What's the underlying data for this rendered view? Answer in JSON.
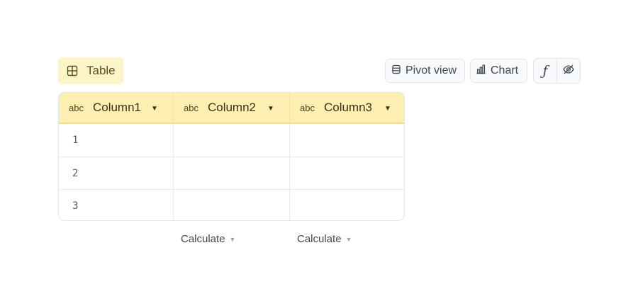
{
  "tabs": {
    "table_label": "Table"
  },
  "toolbar": {
    "pivot_label": "Pivot view",
    "chart_label": "Chart",
    "formula_glyph": "ƒ"
  },
  "columns": [
    {
      "type": "abc",
      "name": "Column1"
    },
    {
      "type": "abc",
      "name": "Column2"
    },
    {
      "type": "abc",
      "name": "Column3"
    }
  ],
  "rows": [
    {
      "col1": "1",
      "col2": "",
      "col3": ""
    },
    {
      "col1": "2",
      "col2": "",
      "col3": ""
    },
    {
      "col1": "3",
      "col2": "",
      "col3": ""
    }
  ],
  "footer": {
    "col2_calc": "Calculate",
    "col3_calc": "Calculate"
  },
  "glyphs": {
    "caret": "▼"
  },
  "icons": {
    "table_tab": "table-grid-icon",
    "pivot": "database-icon",
    "chart": "bar-chart-icon",
    "formula": "function-icon",
    "hide": "eye-off-icon",
    "column_menu": "caret-down-icon"
  },
  "colors": {
    "header_bg": "#fdefb2",
    "tab_bg": "#fdf4c8",
    "border": "#e3e4e8"
  }
}
